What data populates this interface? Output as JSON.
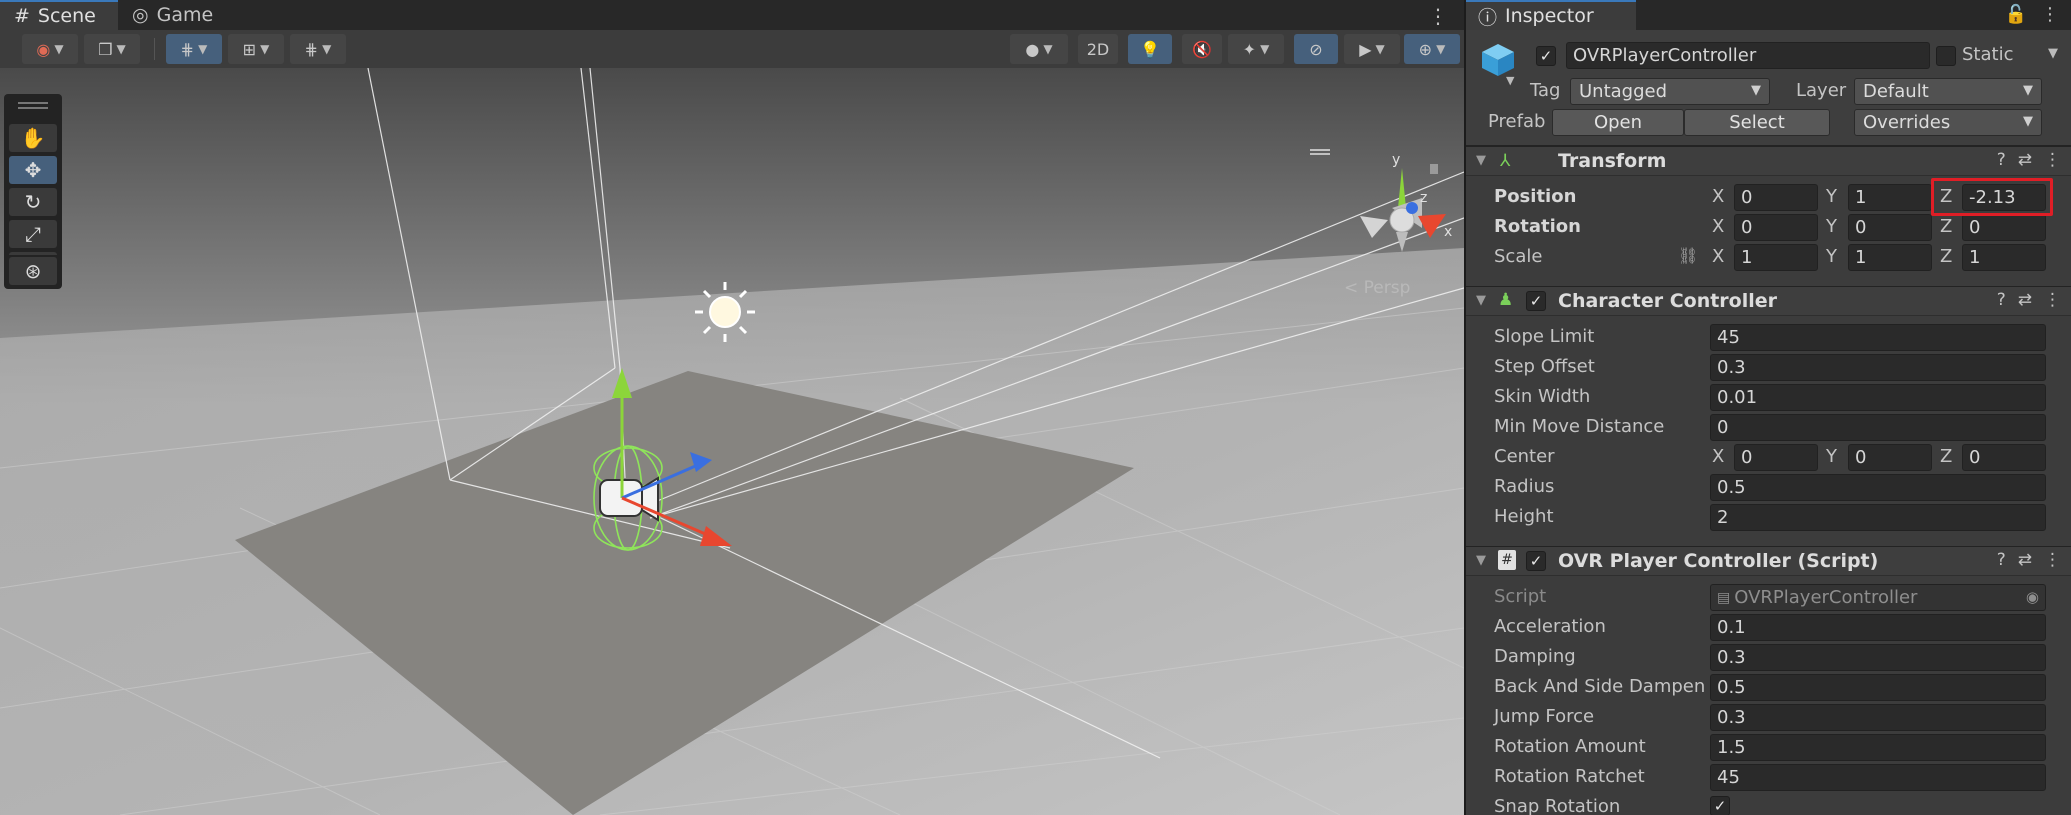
{
  "scene": {
    "tabs": [
      {
        "label": "Scene",
        "icon": "grid-icon"
      },
      {
        "label": "Game",
        "icon": "gamepad-icon"
      }
    ],
    "toolbar": {
      "mode_2d_label": "2D"
    },
    "persp_label": "< Persp",
    "gizmo_axes": {
      "x": "x",
      "y": "y",
      "z": "z"
    }
  },
  "inspector": {
    "tab_label": "Inspector",
    "object": {
      "name": "OVRPlayerController",
      "active": true,
      "static_label": "Static",
      "tag_label": "Tag",
      "tag_value": "Untagged",
      "layer_label": "Layer",
      "layer_value": "Default",
      "prefab_label": "Prefab",
      "open_label": "Open",
      "select_label": "Select",
      "overrides_label": "Overrides"
    },
    "transform": {
      "title": "Transform",
      "position_label": "Position",
      "rotation_label": "Rotation",
      "scale_label": "Scale",
      "position": {
        "x": "0",
        "y": "1",
        "z": "-2.13"
      },
      "rotation": {
        "x": "0",
        "y": "0",
        "z": "0"
      },
      "scale": {
        "x": "1",
        "y": "1",
        "z": "1"
      }
    },
    "character_controller": {
      "title": "Character Controller",
      "fields": [
        {
          "label": "Slope Limit",
          "value": "45"
        },
        {
          "label": "Step Offset",
          "value": "0.3"
        },
        {
          "label": "Skin Width",
          "value": "0.01"
        },
        {
          "label": "Min Move Distance",
          "value": "0"
        }
      ],
      "center_label": "Center",
      "center": {
        "x": "0",
        "y": "0",
        "z": "0"
      },
      "radius_label": "Radius",
      "radius": "0.5",
      "height_label": "Height",
      "height": "2"
    },
    "ovr_script": {
      "title": "OVR Player Controller (Script)",
      "script_label": "Script",
      "script_value": "OVRPlayerController",
      "fields": [
        {
          "label": "Acceleration",
          "value": "0.1"
        },
        {
          "label": "Damping",
          "value": "0.3"
        },
        {
          "label": "Back And Side Dampen",
          "value": "0.5"
        },
        {
          "label": "Jump Force",
          "value": "0.3"
        },
        {
          "label": "Rotation Amount",
          "value": "1.5"
        },
        {
          "label": "Rotation Ratchet",
          "value": "45"
        }
      ],
      "snap_rotation_label": "Snap Rotation",
      "snap_rotation": true
    },
    "axis_labels": {
      "x": "X",
      "y": "Y",
      "z": "Z"
    }
  },
  "colors": {
    "accent": "#3a79bb",
    "highlight_box": "#e01e26",
    "gizmo_x": "#e8472f",
    "gizmo_y": "#8cd53a",
    "gizmo_z": "#3a6fe0"
  }
}
